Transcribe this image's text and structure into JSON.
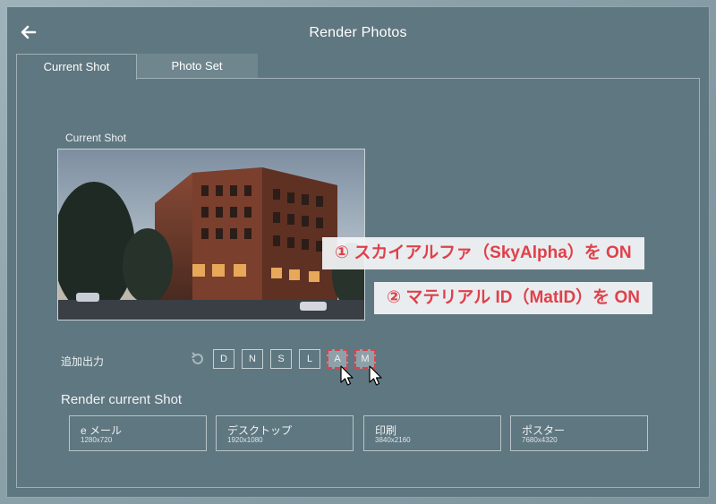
{
  "window": {
    "title": "Render Photos"
  },
  "tabs": [
    {
      "label": "Current Shot",
      "active": true
    },
    {
      "label": "Photo Set",
      "active": false
    }
  ],
  "current_shot": {
    "label": "Current Shot"
  },
  "callouts": [
    {
      "text": "① スカイアルファ（SkyAlpha）を ON"
    },
    {
      "text": "② マテリアル ID（MatID）を ON"
    }
  ],
  "additional_output": {
    "label": "追加出力",
    "toggles": [
      {
        "label": "D",
        "on": false
      },
      {
        "label": "N",
        "on": false
      },
      {
        "label": "S",
        "on": false
      },
      {
        "label": "L",
        "on": false
      },
      {
        "label": "A",
        "on": true
      },
      {
        "label": "M",
        "on": true
      }
    ]
  },
  "render": {
    "heading": "Render current Shot",
    "presets": [
      {
        "name": "e メール",
        "resolution": "1280x720"
      },
      {
        "name": "デスクトップ",
        "resolution": "1920x1080"
      },
      {
        "name": "印刷",
        "resolution": "3840x2160"
      },
      {
        "name": "ポスター",
        "resolution": "7680x4320"
      }
    ]
  },
  "colors": {
    "accent_red": "#e0404a",
    "window_bg": "#5f7780",
    "border": "#9fb0b7"
  }
}
